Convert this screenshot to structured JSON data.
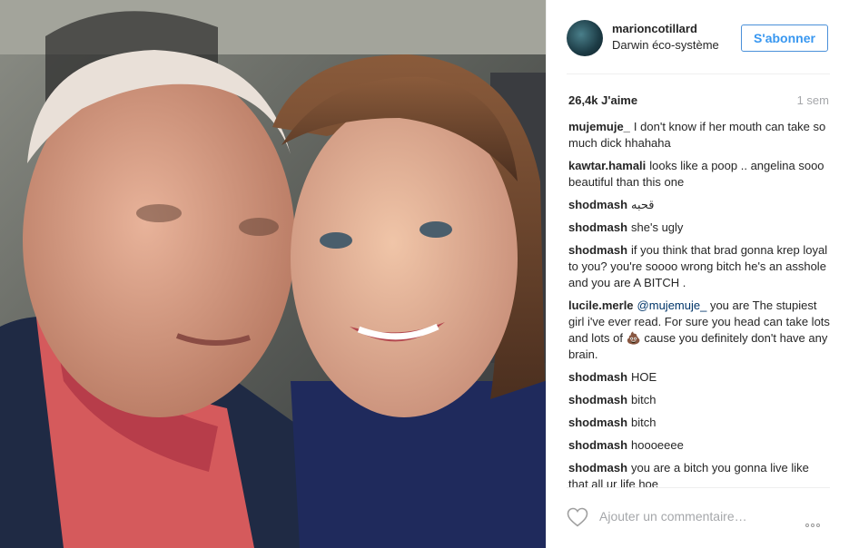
{
  "post": {
    "username": "marioncotillard",
    "location": "Darwin éco-système",
    "follow_label": "S'abonner",
    "likes": "26,4k J'aime",
    "time": "1 sem",
    "add_comment_placeholder": "Ajouter un commentaire…"
  },
  "comments": [
    {
      "author": "mujemuje_",
      "text": "I don't know if her mouth can take so much dick hhahaha"
    },
    {
      "author": "kawtar.hamali",
      "text": "looks like a poop .. angelina sooo beautiful than this one"
    },
    {
      "author": "shodmash",
      "text": "قحبه"
    },
    {
      "author": "shodmash",
      "text": "she's ugly"
    },
    {
      "author": "shodmash",
      "text": "if you think that brad gonna krep loyal to you? you're soooo wrong bitch he's an asshole and you are A BITCH ."
    },
    {
      "author": "lucile.merle",
      "mention": "@mujemuje_",
      "text": " you are The stupiest girl i've ever read. For sure you head can take lots and lots of 💩 cause you definitely don't have any brain."
    },
    {
      "author": "shodmash",
      "text": "HOE"
    },
    {
      "author": "shodmash",
      "text": "bitch"
    },
    {
      "author": "shodmash",
      "text": "bitch"
    },
    {
      "author": "shodmash",
      "text": "hoooeeee"
    },
    {
      "author": "shodmash",
      "text": "you are a bitch you gonna live like that all ur life hoe"
    }
  ],
  "colors": {
    "follow_blue": "#3897f0",
    "mention_blue": "#003569",
    "muted_gray": "#a5a7aa"
  },
  "icons": {
    "heart": "heart-outline-icon",
    "more": "ellipsis-icon"
  }
}
